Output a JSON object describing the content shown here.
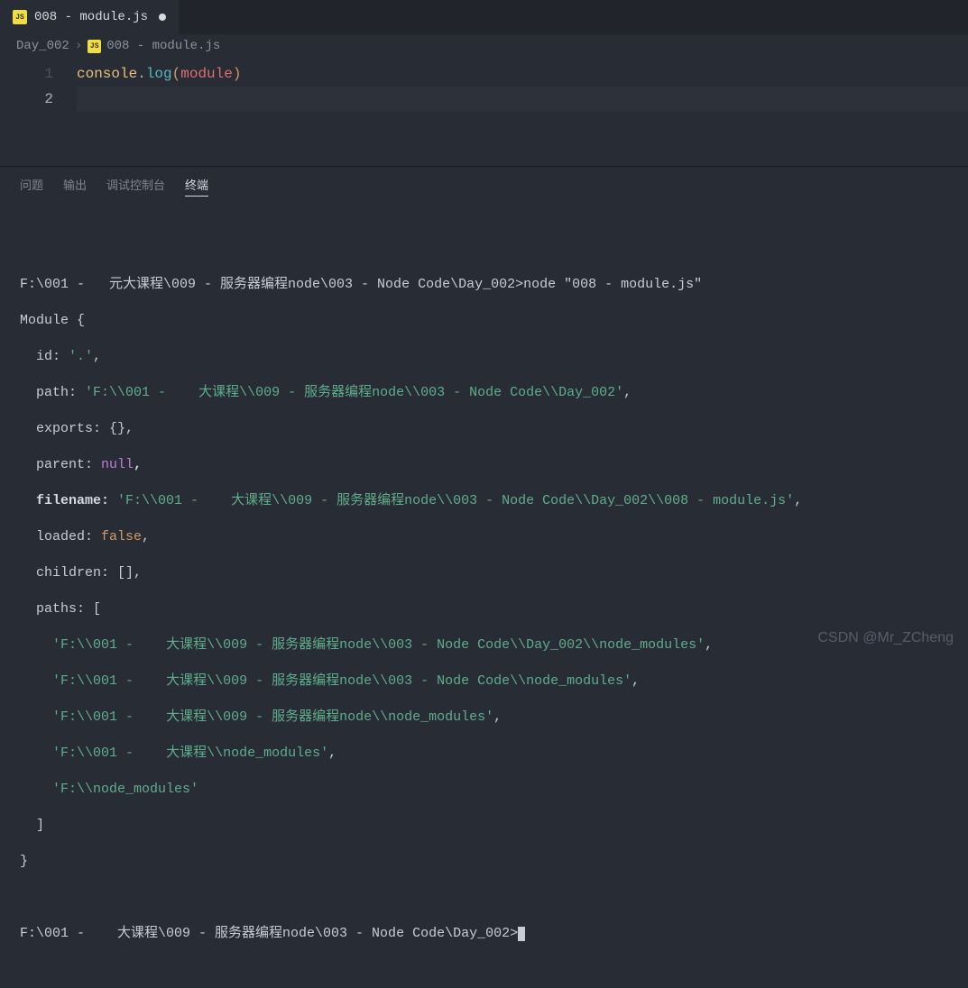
{
  "tab": {
    "icon": "JS",
    "title": "008 - module.js",
    "dirty": true
  },
  "breadcrumb": {
    "seg1": "Day_002",
    "icon": "JS",
    "seg2": "008 - module.js"
  },
  "editor": {
    "line1": {
      "num": "1",
      "console": "console",
      "dot": ".",
      "log": "log",
      "lp": "(",
      "module": "module",
      "rp": ")"
    },
    "line2": {
      "num": "2"
    }
  },
  "panel": {
    "tabs": {
      "problems": "问题",
      "output": "输出",
      "debug": "调试控制台",
      "terminal": "终端"
    }
  },
  "terminal": {
    "prompt1_pre": "F:\\001 - ",
    "prompt1_post": "元大课程\\009 - 服务器编程node\\003 - Node Code\\Day_002>node \"008 - module.js\"",
    "module_open": "Module {",
    "id_label": "  id: ",
    "id_val": "'.'",
    "comma": ",",
    "path_label": "  path: ",
    "path_val_pre": "'F:\\\\001 - ",
    "path_val_post": "大课程\\\\009 - 服务器编程node\\\\003 - Node Code\\\\Day_002'",
    "exports": "  exports: {},",
    "parent_label": "  parent: ",
    "parent_val": "null",
    "filename_label": "filename:",
    "filename_val_pre": "'F:\\\\001 - ",
    "filename_val_post": "大课程\\\\009 - 服务器编程node\\\\003 - Node Code\\\\Day_002\\\\008 - module.js'",
    "loaded_label": "  loaded: ",
    "loaded_val": "false",
    "children": "  children: [],",
    "paths_open": "  paths: [",
    "p1_pre": "'F:\\\\001 - ",
    "p1_post": "大课程\\\\009 - 服务器编程node\\\\003 - Node Code\\\\Day_002\\\\node_modules'",
    "p2_pre": "'F:\\\\001 - ",
    "p2_post": "大课程\\\\009 - 服务器编程node\\\\003 - Node Code\\\\node_modules'",
    "p3_pre": "'F:\\\\001 - ",
    "p3_post": "大课程\\\\009 - 服务器编程node\\\\node_modules'",
    "p4_pre": "'F:\\\\001 - ",
    "p4_post": "大课程\\\\node_modules'",
    "p5": "'F:\\\\node_modules'",
    "paths_close": "  ]",
    "module_close": "}",
    "prompt2_pre": "F:\\001 - ",
    "prompt2_post": "大课程\\009 - 服务器编程node\\003 - Node Code\\Day_002>"
  },
  "watermark": "CSDN @Mr_ZCheng"
}
